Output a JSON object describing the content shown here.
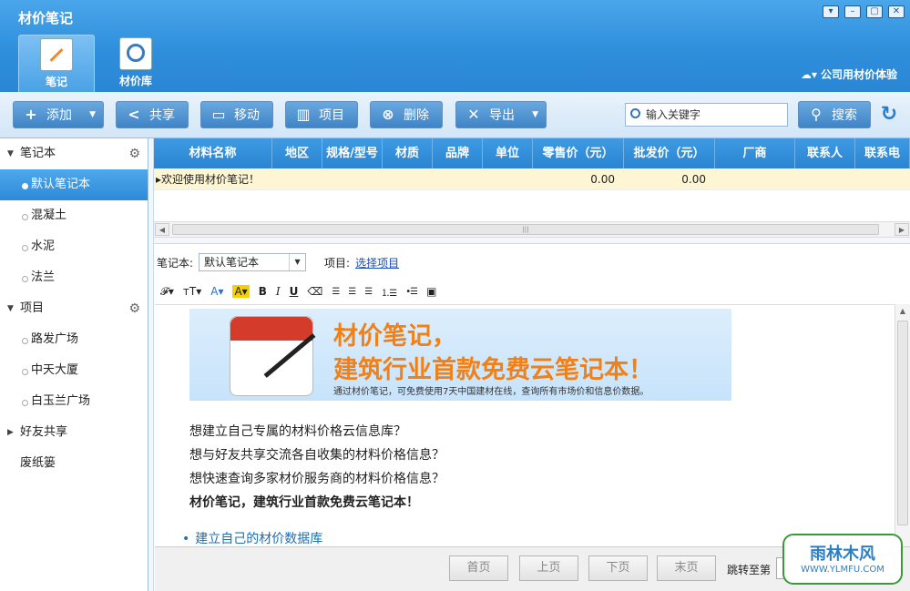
{
  "app": {
    "title": "材价笔记"
  },
  "window_controls": [
    "▾",
    "–",
    "▢",
    "✕"
  ],
  "main_tabs": [
    {
      "label": "笔记",
      "icon": "notebook-pen-icon",
      "active": true
    },
    {
      "label": "材价库",
      "icon": "search-document-icon",
      "active": false
    }
  ],
  "account": {
    "label": "公司用材价体验"
  },
  "toolbar": {
    "add": "添加",
    "share": "共享",
    "move": "移动",
    "project": "项目",
    "delete": "删除",
    "export": "导出",
    "search_placeholder": "输入关键字",
    "search": "搜索"
  },
  "sidebar": {
    "notebooks_header": "笔记本",
    "notebooks": [
      "默认笔记本",
      "混凝土",
      "水泥",
      "法兰"
    ],
    "active_notebook": "默认笔记本",
    "projects_header": "项目",
    "projects": [
      "路发广场",
      "中天大厦",
      "白玉兰广场"
    ],
    "friends_share": "好友共享",
    "trash": "废纸篓"
  },
  "grid": {
    "columns": [
      "材料名称",
      "地区",
      "规格/型号",
      "材质",
      "品牌",
      "单位",
      "零售价（元）",
      "批发价（元）",
      "厂商",
      "联系人",
      "联系电"
    ],
    "rows": [
      {
        "name": "欢迎使用材价笔记！",
        "retail": "0.00",
        "wholesale": "0.00"
      }
    ]
  },
  "editor": {
    "notebook_label": "笔记本:",
    "notebook_value": "默认笔记本",
    "project_label": "项目:",
    "project_link": "选择项目",
    "banner_title1": "材价笔记，",
    "banner_title2": "建筑行业首款免费云笔记本！",
    "banner_sub": "通过材价笔记，可免费使用7天中国建材在线，查询所有市场价和信息价数据。",
    "p1": "想建立自己专属的材料价格云信息库？",
    "p2": "想与好友共享交流各自收集的材料价格信息？",
    "p3": "想快速查询多家材价服务商的材料价格信息？",
    "p4": "材价笔记，建筑行业首款免费云笔记本！",
    "bullet1": "建立自己的材价数据库"
  },
  "pager": {
    "first": "首页",
    "prev": "上页",
    "next": "下页",
    "last": "末页",
    "jump": "跳转至第"
  },
  "watermark": {
    "line1": "雨林木风",
    "line2": "WWW.YLMFU.COM"
  },
  "colors": {
    "header": "#2f8fdc",
    "accent": "#f08118",
    "row_highlight": "#fdf5d4"
  }
}
